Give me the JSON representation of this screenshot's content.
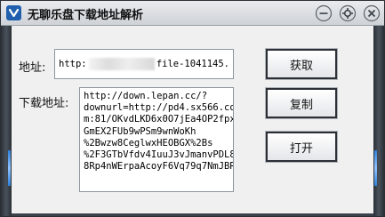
{
  "window": {
    "title": "无聊乐盘下载地址解析"
  },
  "form": {
    "address_label": "地址:",
    "address_value_start": "http:",
    "address_value_end": "file-1041145.",
    "download_label": "下载地址:",
    "download_value": "http://down.lepan.cc/?\ndownurl=http://pd4.sx566.co\nm:81/OKvdLKD6x0O7jEa4OP2fpx\nGmEX2FUb9wPSm9wnWoKh\n%2Bwzw8CeglwxHEOBGX%2Bs\n%2F3GTbVfdv4IuuJ3vJmanvPDL8\n8Rp4nWErpaAcoyF6Vq79q7NmJBR"
  },
  "buttons": {
    "get_label": "获取",
    "copy_label": "复制",
    "open_label": "打开"
  },
  "title_icons": [
    "minimize-icon",
    "settings-icon",
    "close-icon"
  ],
  "colors": {
    "frame": "#2b2f35",
    "accent_blue": "#2f7fd8",
    "icon_blue": "#1f5fae"
  }
}
